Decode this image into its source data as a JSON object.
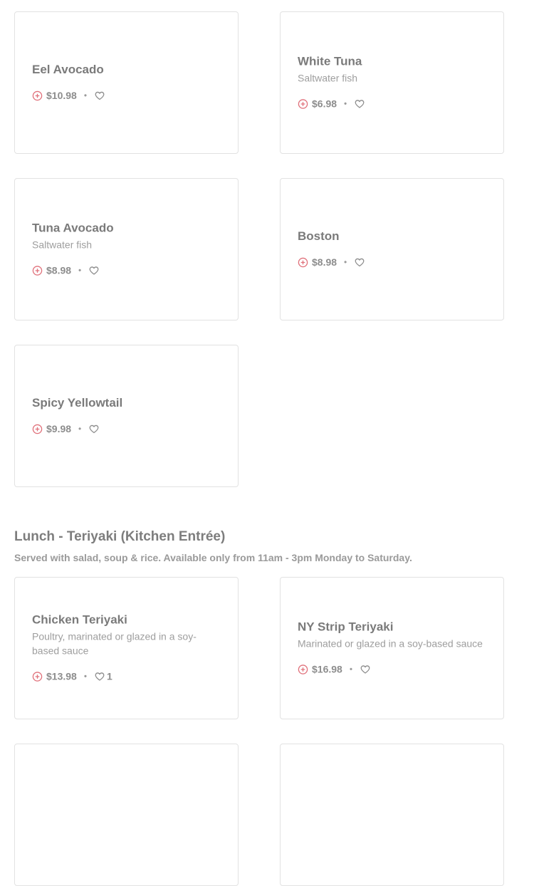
{
  "items": [
    {
      "name": "Eel Avocado",
      "desc": "",
      "price": "$10.98",
      "likes": ""
    },
    {
      "name": "White Tuna",
      "desc": "Saltwater fish",
      "price": "$6.98",
      "likes": ""
    },
    {
      "name": "Tuna Avocado",
      "desc": "Saltwater fish",
      "price": "$8.98",
      "likes": ""
    },
    {
      "name": "Boston",
      "desc": "",
      "price": "$8.98",
      "likes": ""
    },
    {
      "name": "Spicy Yellowtail",
      "desc": "",
      "price": "$9.98",
      "likes": ""
    }
  ],
  "section": {
    "title": "Lunch - Teriyaki (Kitchen Entrée)",
    "subtitle": "Served with salad, soup & rice. Available only from 11am - 3pm Monday to Saturday."
  },
  "section_items": [
    {
      "name": "Chicken Teriyaki",
      "desc": "Poultry, marinated or glazed in a soy-based sauce",
      "price": "$13.98",
      "likes": "1"
    },
    {
      "name": "NY Strip Teriyaki",
      "desc": "Marinated or glazed in a soy-based sauce",
      "price": "$16.98",
      "likes": ""
    }
  ],
  "meta": {
    "separator": "•"
  },
  "icons": {
    "add": "plus-circle-icon",
    "favorite": "heart-icon"
  },
  "colors": {
    "accent": "#e0707a",
    "border": "#e2e2e2"
  }
}
